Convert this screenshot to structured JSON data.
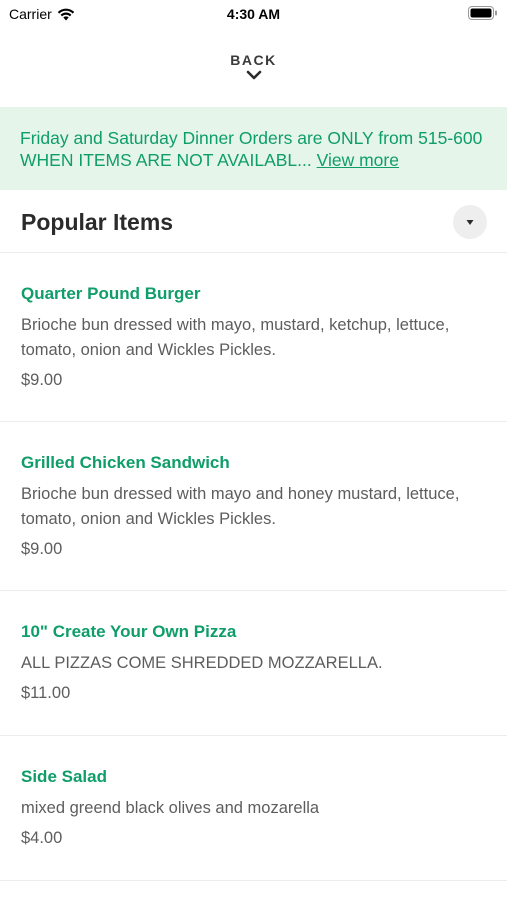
{
  "status_bar": {
    "carrier": "Carrier",
    "time": "4:30 AM"
  },
  "nav": {
    "back_label": "BACK"
  },
  "banner": {
    "text": "Friday and Saturday Dinner Orders are ONLY from 515-600 WHEN ITEMS ARE NOT AVAILABL...",
    "link": "View more",
    "background": "#e5f5ea",
    "color": "#0f9d6a"
  },
  "section": {
    "title": "Popular Items"
  },
  "items": [
    {
      "name": "Quarter Pound Burger",
      "description": "Brioche bun dressed with mayo, mustard, ketchup, lettuce, tomato, onion and Wickles Pickles.",
      "price": "$9.00"
    },
    {
      "name": "Grilled Chicken Sandwich",
      "description": "Brioche bun dressed with mayo and honey mustard, lettuce, tomato, onion and Wickles Pickles.",
      "price": "$9.00"
    },
    {
      "name": "10\" Create Your Own Pizza",
      "description": "ALL PIZZAS COME SHREDDED MOZZARELLA.",
      "price": "$11.00"
    },
    {
      "name": "Side Salad",
      "description": "mixed greend black olives and mozarella",
      "price": "$4.00"
    }
  ],
  "colors": {
    "accent": "#0f9d6a"
  }
}
